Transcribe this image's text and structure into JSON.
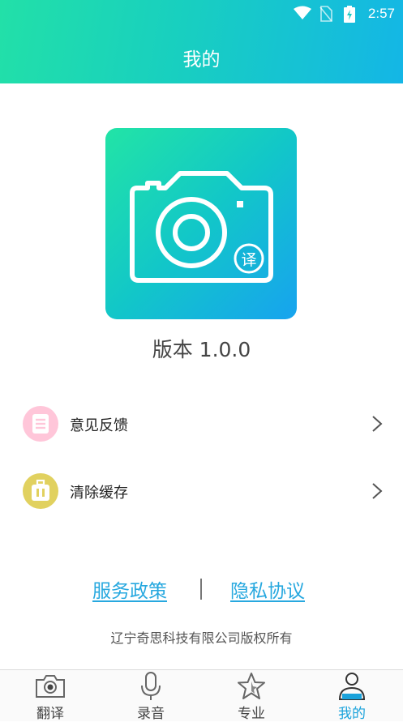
{
  "status_bar": {
    "time": "2:57"
  },
  "header": {
    "title": "我的"
  },
  "app": {
    "badge_char": "译",
    "version": "版本 1.0.0"
  },
  "menu": [
    {
      "label": "意见反馈",
      "icon": "feedback-icon",
      "icon_color": "#ffc6d9"
    },
    {
      "label": "清除缓存",
      "icon": "clear-cache-icon",
      "icon_color": "#e1d15f"
    }
  ],
  "links": {
    "service": "服务政策",
    "privacy": "隐私协议"
  },
  "copyright": "辽宁奇思科技有限公司版权所有",
  "tabs": [
    {
      "label": "翻译",
      "icon": "camera-icon",
      "active": false
    },
    {
      "label": "录音",
      "icon": "microphone-icon",
      "active": false
    },
    {
      "label": "专业",
      "icon": "star-icon",
      "active": false
    },
    {
      "label": "我的",
      "icon": "person-icon",
      "active": true
    }
  ],
  "colors": {
    "accent": "#1aa2db",
    "header_start": "#22e0a8",
    "header_end": "#14b6e6"
  }
}
